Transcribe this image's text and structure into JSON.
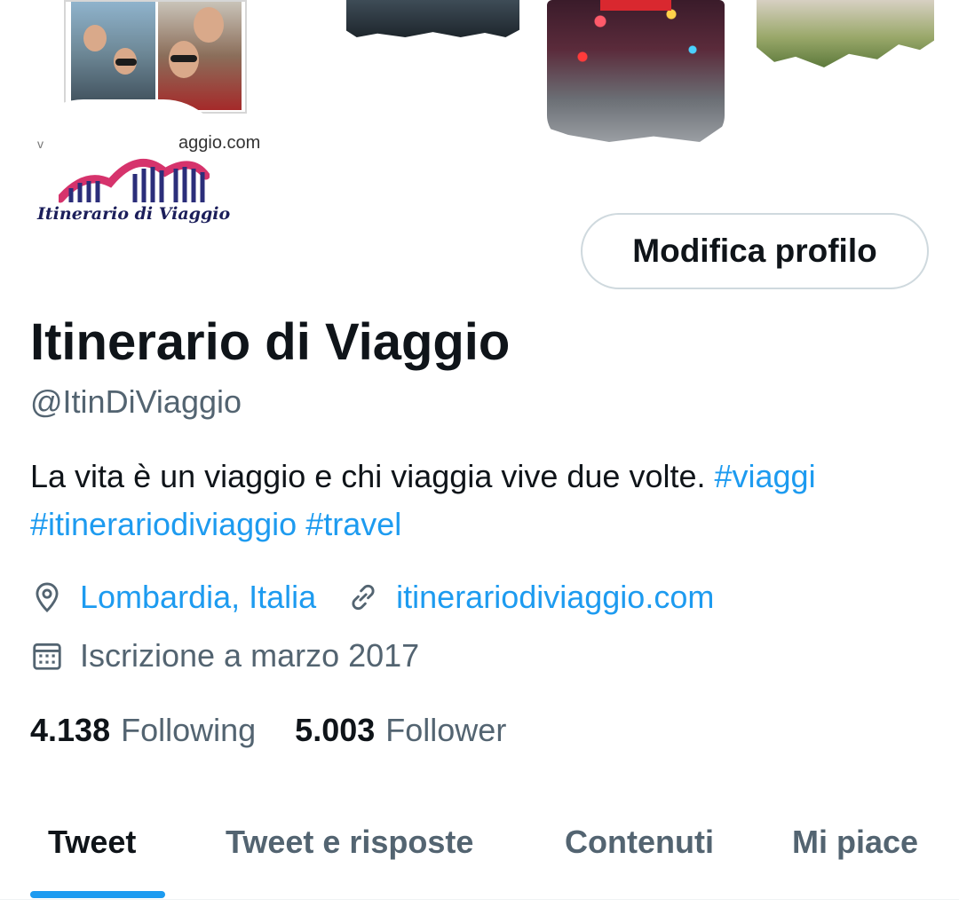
{
  "banner": {
    "photo_alt": "couple-selfie-photos",
    "images": [
      "harbor-boat-photo",
      "neon-city-street-photo",
      "garden-villa-photo"
    ]
  },
  "avatar": {
    "url_text": "aggio.com",
    "url_ghost": "v",
    "logo_text": "Itinerario di Viaggio",
    "logo_colors": {
      "arch": "#d6336c",
      "bars": "#2b2e7a"
    }
  },
  "header": {
    "edit_button_label": "Modifica profilo"
  },
  "profile": {
    "display_name": "Itinerario di Viaggio",
    "handle": "@ItinDiViaggio",
    "bio_text": "La vita è un viaggio e chi viaggia vive due volte. ",
    "bio_tags": [
      "#viaggi",
      "#itinerariodiviaggio",
      "#travel"
    ],
    "location": "Lombardia, Italia",
    "website": "itinerariodiviaggio.com",
    "joined": "Iscrizione a marzo 2017",
    "icons": {
      "location": "location-pin-icon",
      "website": "link-icon",
      "joined": "calendar-icon"
    }
  },
  "stats": {
    "following_count": "4.138",
    "following_label": "Following",
    "followers_count": "5.003",
    "followers_label": "Follower"
  },
  "tabs": [
    {
      "label": "Tweet",
      "active": true
    },
    {
      "label": "Tweet e risposte",
      "active": false
    },
    {
      "label": "Contenuti",
      "active": false
    },
    {
      "label": "Mi piace",
      "active": false
    }
  ],
  "colors": {
    "accent": "#1d9bf0",
    "text_primary": "#0f1419",
    "text_secondary": "#536471",
    "border": "#cfd9de"
  }
}
